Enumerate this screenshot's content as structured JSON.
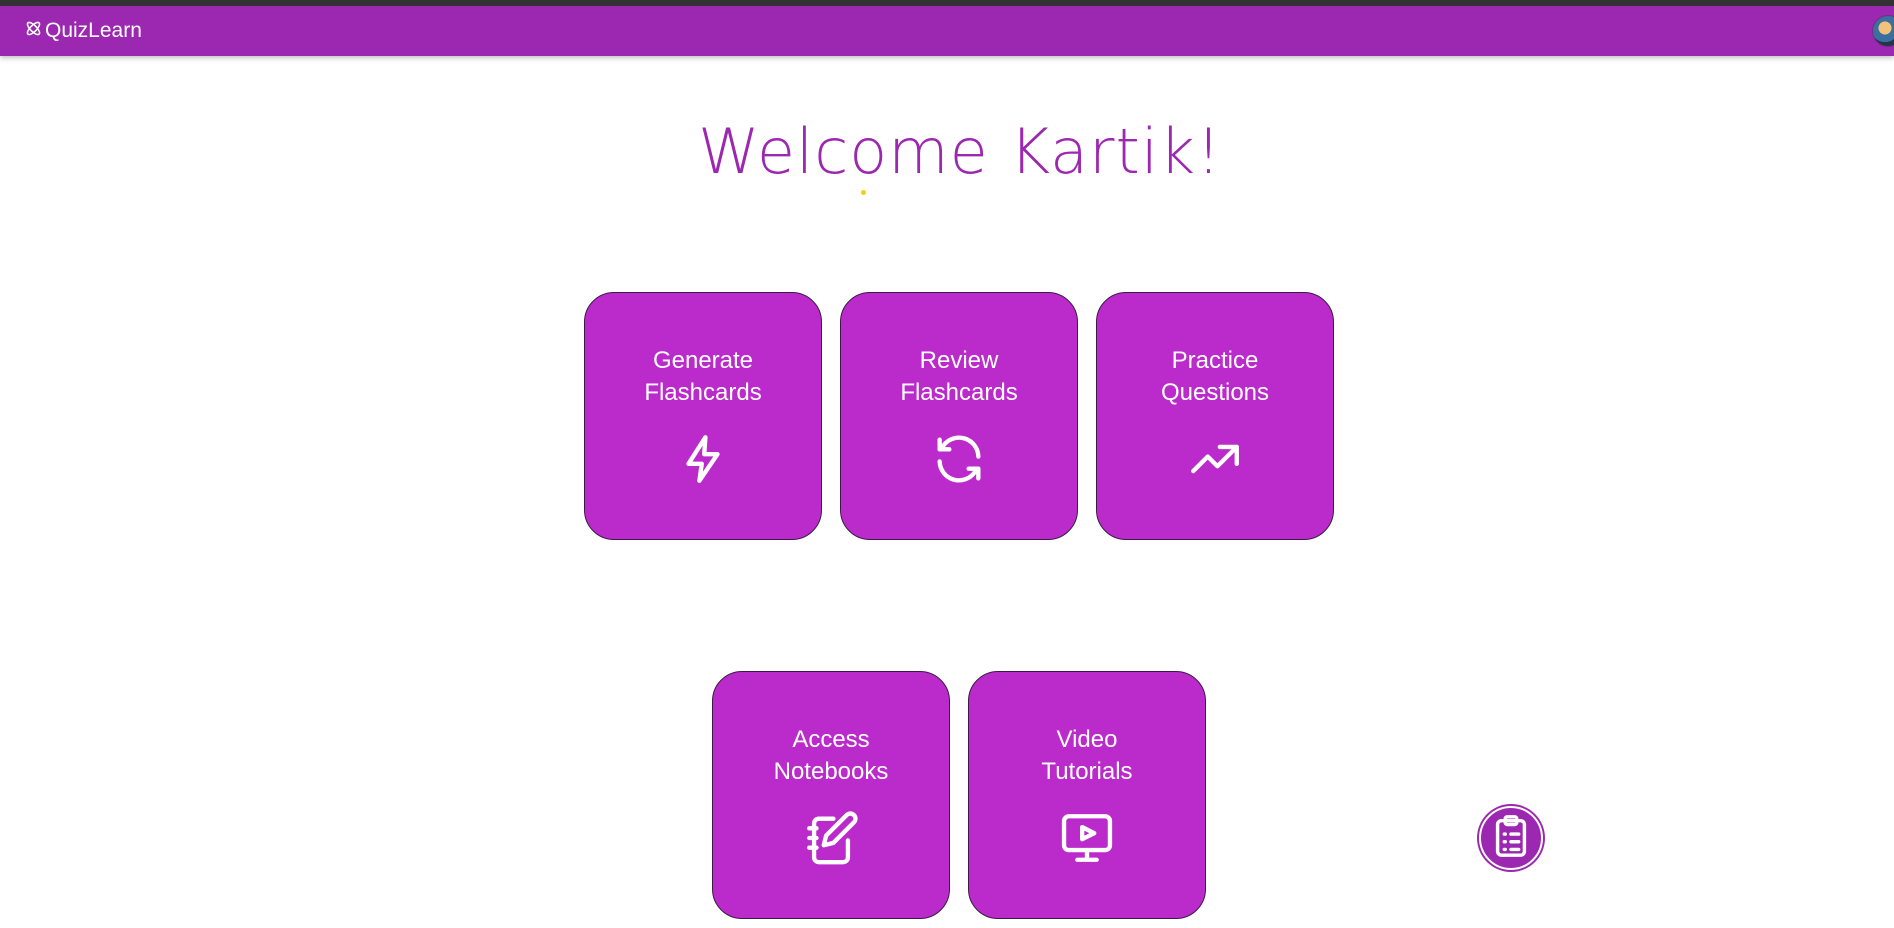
{
  "navbar": {
    "brand": "QuizLearn",
    "brand_icon": "atom-icon",
    "avatar": "user-avatar"
  },
  "welcome": {
    "title": "Welcome Kartik!"
  },
  "cards": [
    {
      "line1": "Generate",
      "line2": "Flashcards",
      "icon": "lightning-icon"
    },
    {
      "line1": "Review",
      "line2": "Flashcards",
      "icon": "refresh-icon"
    },
    {
      "line1": "Practice",
      "line2": "Questions",
      "icon": "trending-up-icon"
    },
    {
      "line1": "Access",
      "line2": "Notebooks",
      "icon": "notebook-pen-icon"
    },
    {
      "line1": "Video",
      "line2": "Tutorials",
      "icon": "video-monitor-icon"
    }
  ],
  "fab": {
    "icon": "clipboard-list-icon"
  },
  "colors": {
    "primary": "#9c27b0",
    "card": "#bb2bcc",
    "accent_dot": "#f5d000"
  }
}
